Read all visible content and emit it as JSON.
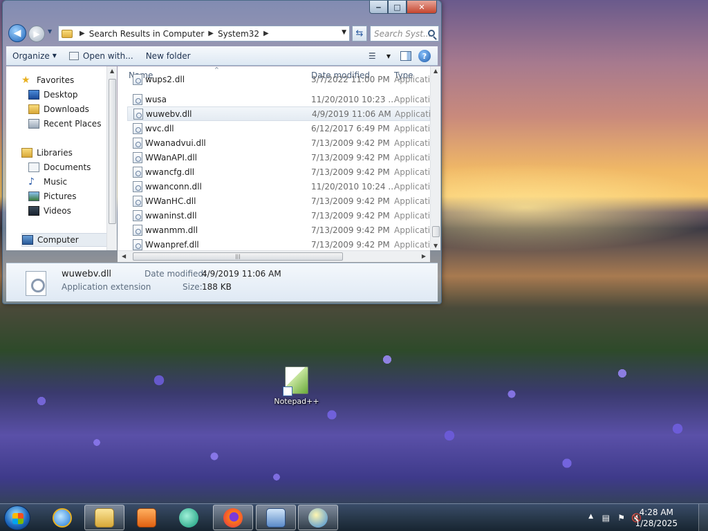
{
  "window": {
    "caption": {
      "minimize": "‒",
      "maximize": "□",
      "close": "✕"
    },
    "address": {
      "crumbs": [
        "Search Results in Computer",
        "System32"
      ],
      "search_placeholder": "Search Syst..."
    },
    "toolbar": {
      "organize": "Organize",
      "open_with": "Open with...",
      "new_folder": "New folder"
    },
    "nav": {
      "favorites": "Favorites",
      "desktop": "Desktop",
      "downloads": "Downloads",
      "recent_places": "Recent Places",
      "libraries": "Libraries",
      "documents": "Documents",
      "music": "Music",
      "pictures": "Pictures",
      "videos": "Videos",
      "computer": "Computer"
    },
    "columns": {
      "name": "Name",
      "date": "Date modified",
      "type": "Type"
    },
    "files": [
      {
        "name": "wups2.dll",
        "date": "3/7/2022 11:00 PM",
        "type": "Applicatio"
      },
      {
        "name": "wusa",
        "date": "11/20/2010 10:23 ...",
        "type": "Applicatio"
      },
      {
        "name": "wuwebv.dll",
        "date": "4/9/2019 11:06 AM",
        "type": "Applicatio"
      },
      {
        "name": "wvc.dll",
        "date": "6/12/2017 6:49 PM",
        "type": "Applicatio"
      },
      {
        "name": "Wwanadvui.dll",
        "date": "7/13/2009 9:42 PM",
        "type": "Applicatio"
      },
      {
        "name": "WWanAPI.dll",
        "date": "7/13/2009 9:42 PM",
        "type": "Applicatio"
      },
      {
        "name": "wwancfg.dll",
        "date": "7/13/2009 9:42 PM",
        "type": "Applicatio"
      },
      {
        "name": "wwanconn.dll",
        "date": "11/20/2010 10:24 ...",
        "type": "Applicatio"
      },
      {
        "name": "WWanHC.dll",
        "date": "7/13/2009 9:42 PM",
        "type": "Applicatio"
      },
      {
        "name": "wwaninst.dll",
        "date": "7/13/2009 9:42 PM",
        "type": "Applicatio"
      },
      {
        "name": "wwanmm.dll",
        "date": "7/13/2009 9:42 PM",
        "type": "Applicatio"
      },
      {
        "name": "Wwanpref.dll",
        "date": "7/13/2009 9:42 PM",
        "type": "Applicatio"
      }
    ],
    "details": {
      "name": "wuwebv.dll",
      "type": "Application extension",
      "date_label": "Date modified:",
      "date_value": "4/9/2019 11:06 AM",
      "size_label": "Size:",
      "size_value": "188 KB"
    }
  },
  "desktop": {
    "icon_label": "Notepad++"
  },
  "taskbar": {
    "time": "4:28 AM",
    "date": "1/28/2025",
    "apps": [
      "internet-explorer",
      "windows-explorer",
      "media-player",
      "browser-globe",
      "firefox",
      "remote-desktop",
      "messenger"
    ]
  },
  "colors": {
    "selection": "#e4ebf2",
    "accent": "#1f64b8"
  }
}
